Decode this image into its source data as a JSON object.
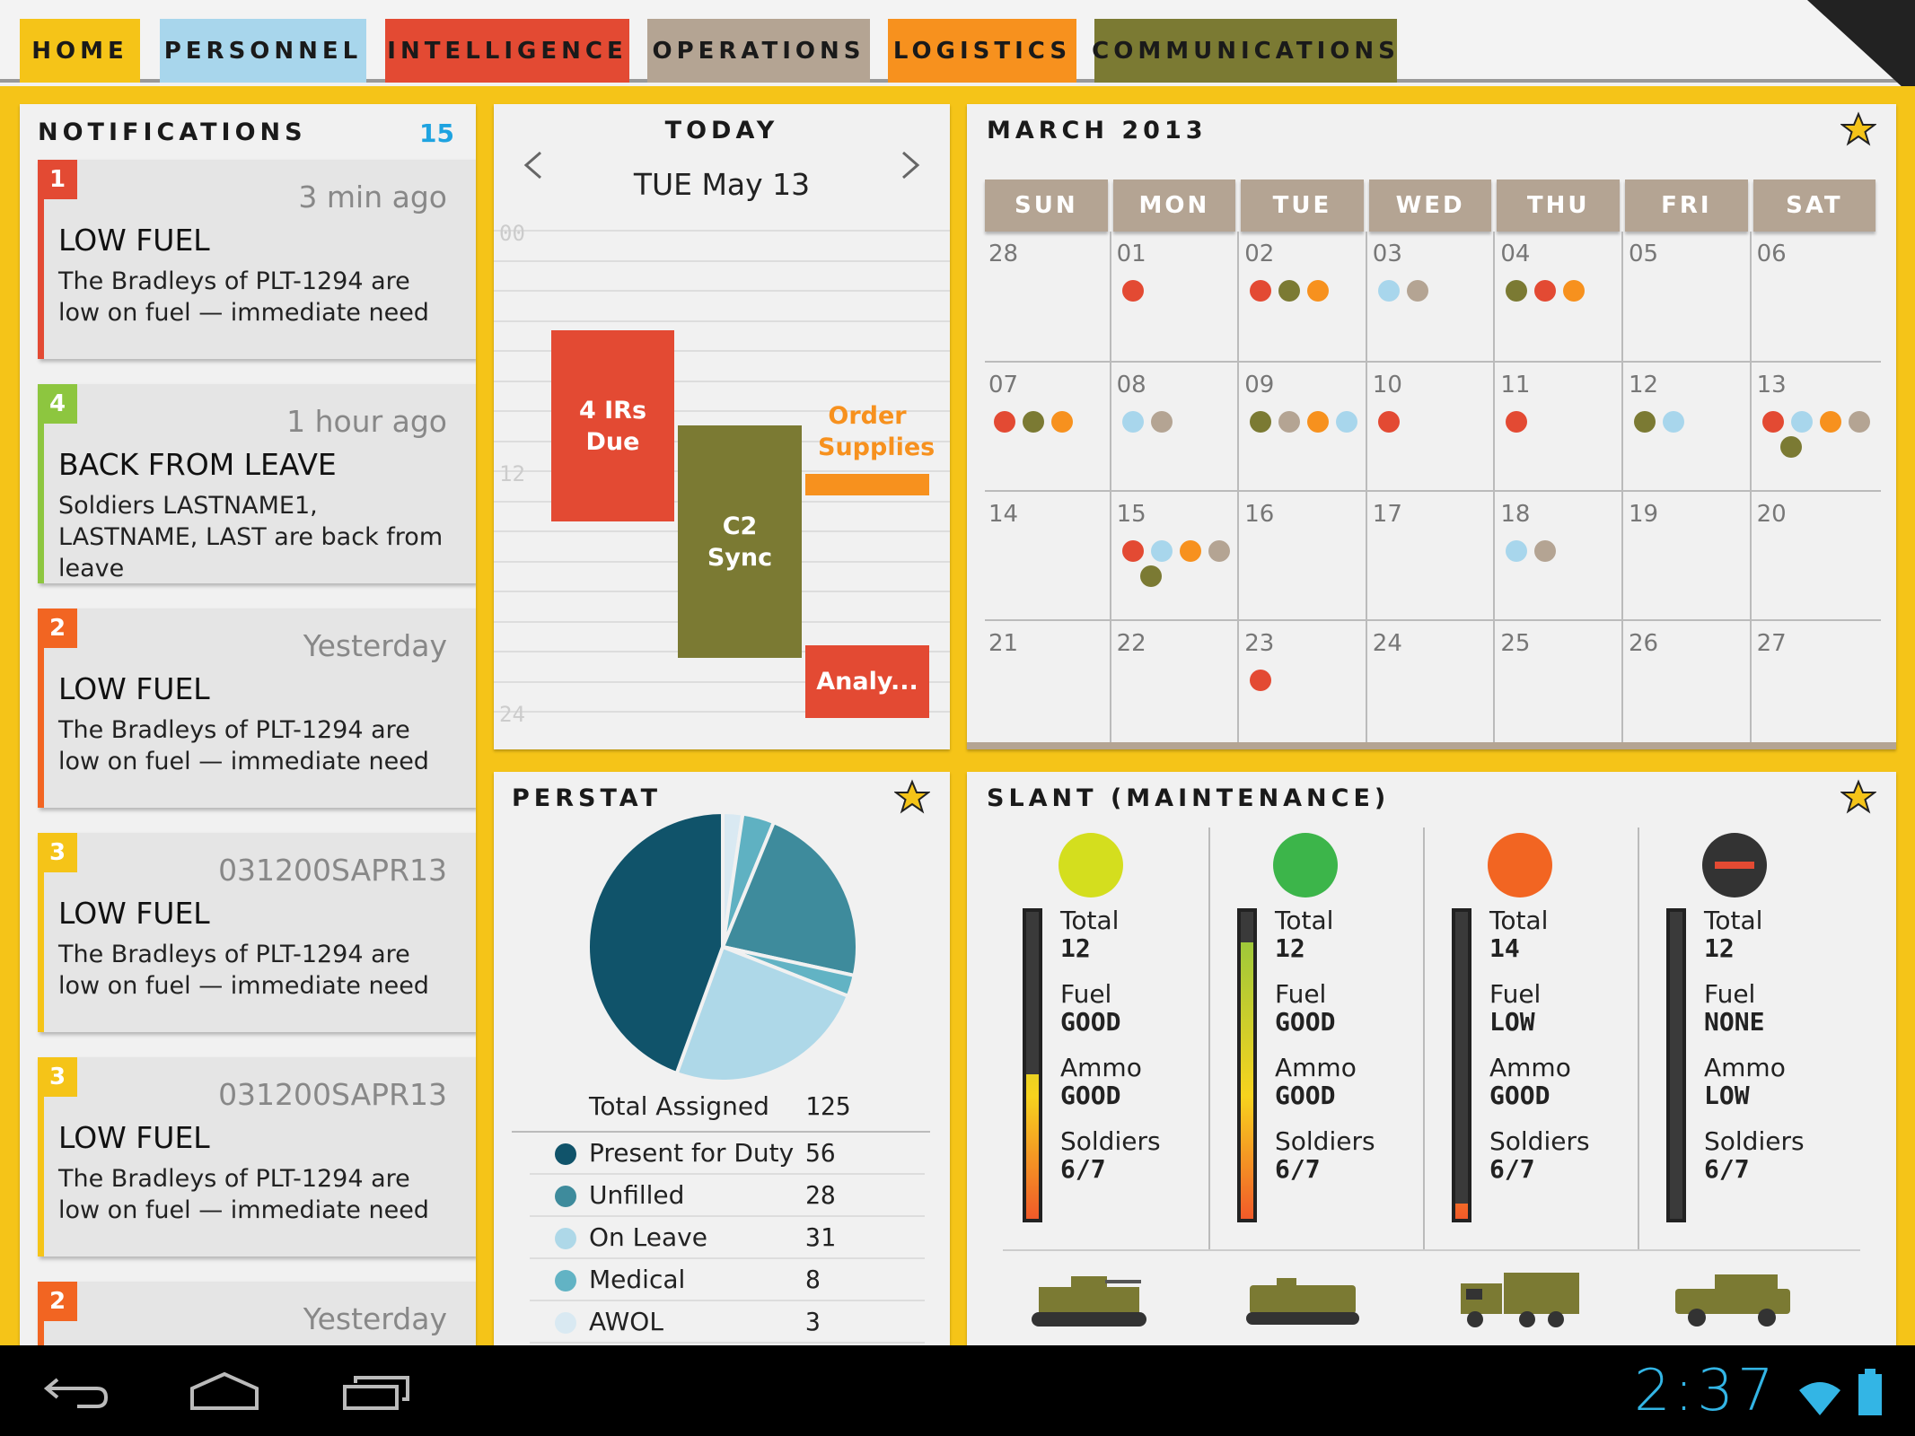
{
  "tabs": [
    {
      "label": "HOME",
      "color": "#f5c418"
    },
    {
      "label": "PERSONNEL",
      "color": "#a8d6ec"
    },
    {
      "label": "INTELLIGENCE",
      "color": "#e34a33"
    },
    {
      "label": "OPERATIONS",
      "color": "#b4a493"
    },
    {
      "label": "LOGISTICS",
      "color": "#f7911e"
    },
    {
      "label": "COMMUNICATIONS",
      "color": "#7b7a33"
    }
  ],
  "notifications": {
    "title": "NOTIFICATIONS",
    "count": "15",
    "items": [
      {
        "badge": "1",
        "color": "#e34a33",
        "time": "3 min ago",
        "title": "LOW FUEL",
        "body": "The Bradleys of PLT-1294 are low on fuel — immediate need"
      },
      {
        "badge": "4",
        "color": "#8dc63f",
        "time": "1 hour ago",
        "title": "BACK FROM LEAVE",
        "body": "Soldiers LASTNAME1, LASTNAME, LAST are back from leave"
      },
      {
        "badge": "2",
        "color": "#f26522",
        "time": "Yesterday",
        "title": "LOW FUEL",
        "body": "The Bradleys of PLT-1294 are low on fuel — immediate need"
      },
      {
        "badge": "3",
        "color": "#f5c418",
        "time": "031200SAPR13",
        "title": "LOW FUEL",
        "body": "The Bradleys of PLT-1294 are low on fuel — immediate need"
      },
      {
        "badge": "3",
        "color": "#f5c418",
        "time": "031200SAPR13",
        "title": "LOW FUEL",
        "body": "The Bradleys of PLT-1294 are low on fuel — immediate need"
      },
      {
        "badge": "2",
        "color": "#f26522",
        "time": "Yesterday",
        "title": "",
        "body": ""
      }
    ]
  },
  "today": {
    "title": "TODAY",
    "date": "TUE May 13",
    "hours": [
      "00",
      "12",
      "24"
    ],
    "events": [
      {
        "label": "4 IRs Due",
        "color": "#e34a33"
      },
      {
        "label": "C2 Sync",
        "color": "#7b7a33"
      },
      {
        "label": "Order Supplies",
        "color": "#f7911e"
      },
      {
        "label": "Analy...",
        "color": "#e34a33"
      }
    ]
  },
  "calendar": {
    "title": "MARCH 2013",
    "days": [
      "SUN",
      "MON",
      "TUE",
      "WED",
      "THU",
      "FRI",
      "SAT"
    ],
    "weeks": [
      [
        "28",
        "01",
        "02",
        "03",
        "04",
        "05",
        "06"
      ],
      [
        "07",
        "08",
        "09",
        "10",
        "11",
        "12",
        "13"
      ],
      [
        "14",
        "15",
        "16",
        "17",
        "18",
        "19",
        "20"
      ],
      [
        "21",
        "22",
        "23",
        "24",
        "25",
        "26",
        "27"
      ]
    ],
    "dots": [
      [
        [],
        [
          "red"
        ],
        [
          "red",
          "olive",
          "orange"
        ],
        [
          "blue",
          "tan"
        ],
        [
          "olive",
          "red",
          "orange"
        ],
        [],
        []
      ],
      [
        [
          "red",
          "olive",
          "orange"
        ],
        [
          "blue",
          "tan"
        ],
        [
          "olive",
          "tan",
          "orange",
          "blue"
        ],
        [
          "red"
        ],
        [
          "red"
        ],
        [
          "olive",
          "blue"
        ],
        [
          "red",
          "blue",
          "orange",
          "tan",
          "olive"
        ]
      ],
      [
        [],
        [
          "red",
          "blue",
          "orange",
          "tan",
          "olive"
        ],
        [],
        [],
        [
          "blue",
          "tan"
        ],
        [],
        []
      ],
      [
        [],
        [],
        [
          "red"
        ],
        [],
        [],
        [],
        []
      ]
    ],
    "dot_colors": {
      "red": "#e34a33",
      "olive": "#7b7a33",
      "orange": "#f7911e",
      "blue": "#a8d6ec",
      "tan": "#b4a493"
    }
  },
  "perstat": {
    "title": "PERSTAT",
    "total_label": "Total Assigned",
    "total_value": "125",
    "rows": [
      {
        "label": "Present for Duty",
        "value": "56",
        "color": "#10536a"
      },
      {
        "label": "Unfilled",
        "value": "28",
        "color": "#3e8b9c"
      },
      {
        "label": "On Leave",
        "value": "31",
        "color": "#aed8e8"
      },
      {
        "label": "Medical",
        "value": "8",
        "color": "#62b3c4"
      },
      {
        "label": "AWOL",
        "value": "3",
        "color": "#d9e9f2"
      }
    ]
  },
  "slant": {
    "title": "SLANT (MAINTENANCE)",
    "units": [
      {
        "status_color": "#d4de1e",
        "total_label": "Total",
        "total": "12",
        "fuel_label": "Fuel",
        "fuel": "GOOD",
        "ammo_label": "Ammo",
        "ammo": "GOOD",
        "soldiers_label": "Soldiers",
        "soldiers": "6/7",
        "level": 0.47,
        "vehicle": "bradley-icon"
      },
      {
        "status_color": "#3cb54a",
        "total_label": "Total",
        "total": "12",
        "fuel_label": "Fuel",
        "fuel": "GOOD",
        "ammo_label": "Ammo",
        "ammo": "GOOD",
        "soldiers_label": "Soldiers",
        "soldiers": "6/7",
        "level": 0.9,
        "vehicle": "apc-icon"
      },
      {
        "status_color": "#f26522",
        "total_label": "Total",
        "total": "14",
        "fuel_label": "Fuel",
        "fuel": "LOW",
        "ammo_label": "Ammo",
        "ammo": "GOOD",
        "soldiers_label": "Soldiers",
        "soldiers": "6/7",
        "level": 0.05,
        "vehicle": "truck-icon"
      },
      {
        "status_color": "#333333",
        "total_label": "Total",
        "total": "12",
        "fuel_label": "Fuel",
        "fuel": "NONE",
        "ammo_label": "Ammo",
        "ammo": "LOW",
        "soldiers_label": "Soldiers",
        "soldiers": "6/7",
        "level": 0,
        "vehicle": "humvee-icon"
      }
    ]
  },
  "status_bar": {
    "time": "2:37"
  }
}
